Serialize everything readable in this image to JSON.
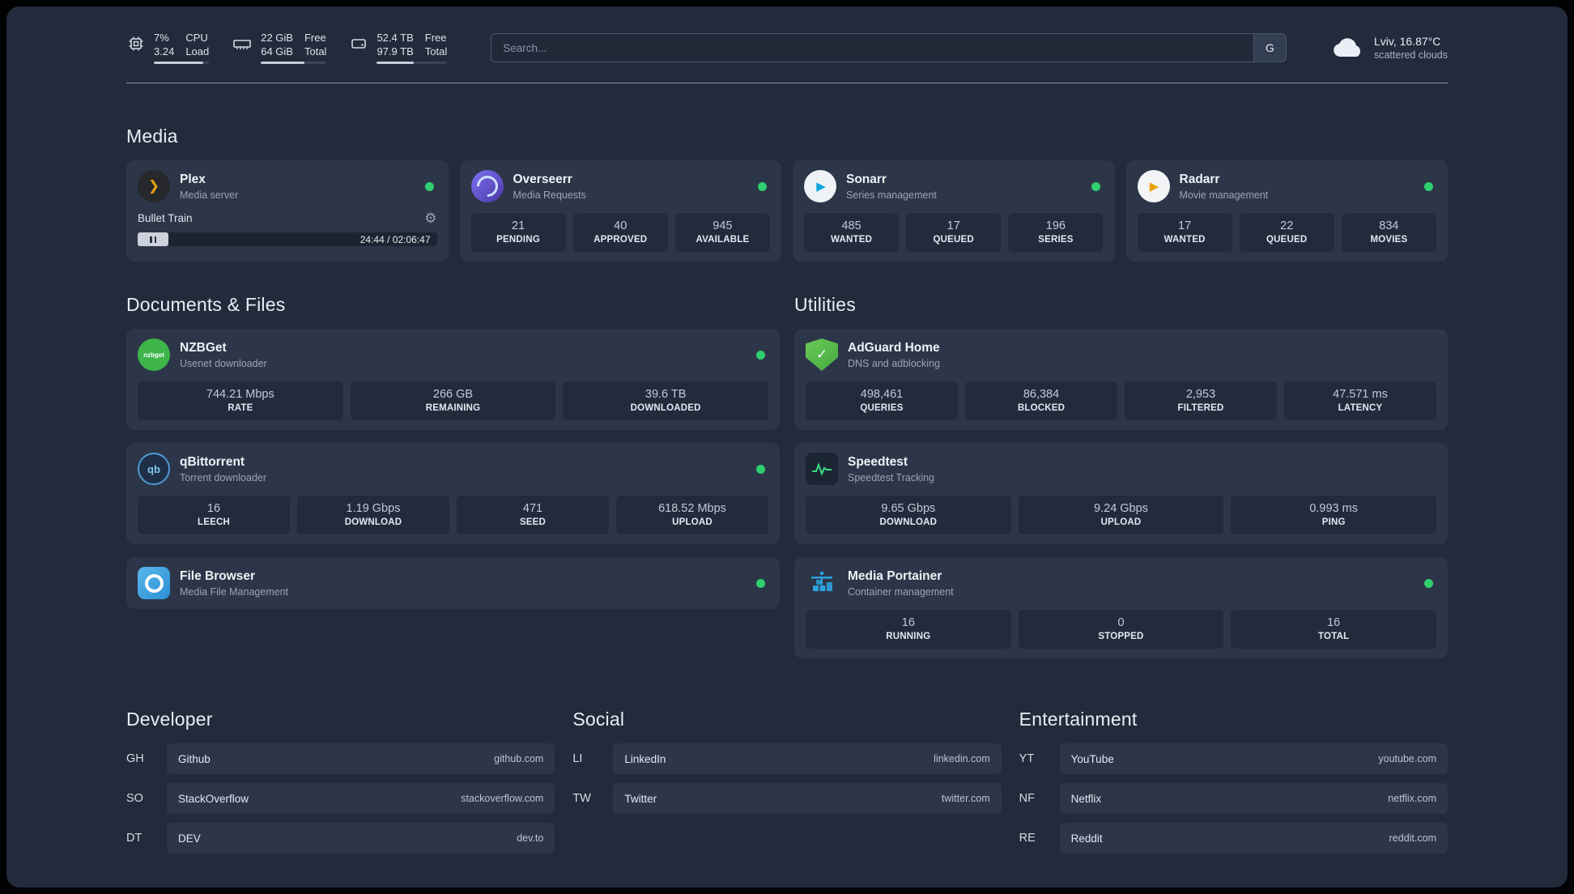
{
  "topbar": {
    "cpu": {
      "usage": "7%",
      "load": "3.24",
      "label_top": "CPU",
      "label_bottom": "Load"
    },
    "ram": {
      "free": "22 GiB",
      "total": "64 GiB",
      "label_top": "Free",
      "label_bottom": "Total"
    },
    "disk": {
      "free": "52.4 TB",
      "total": "97.9 TB",
      "label_top": "Free",
      "label_bottom": "Total"
    },
    "search": {
      "placeholder": "Search...",
      "button_label": "G"
    },
    "weather": {
      "location": "Lviv, 16.87°C",
      "condition": "scattered clouds"
    }
  },
  "sections": {
    "media": "Media",
    "documents": "Documents & Files",
    "utilities": "Utilities",
    "developer": "Developer",
    "social": "Social",
    "entertainment": "Entertainment"
  },
  "apps": {
    "plex": {
      "name": "Plex",
      "subtitle": "Media server",
      "now_playing": "Bullet Train",
      "time": "24:44 / 02:06:47"
    },
    "overseerr": {
      "name": "Overseerr",
      "subtitle": "Media Requests",
      "stats": [
        {
          "value": "21",
          "label": "PENDING"
        },
        {
          "value": "40",
          "label": "APPROVED"
        },
        {
          "value": "945",
          "label": "AVAILABLE"
        }
      ]
    },
    "sonarr": {
      "name": "Sonarr",
      "subtitle": "Series management",
      "stats": [
        {
          "value": "485",
          "label": "WANTED"
        },
        {
          "value": "17",
          "label": "QUEUED"
        },
        {
          "value": "196",
          "label": "SERIES"
        }
      ]
    },
    "radarr": {
      "name": "Radarr",
      "subtitle": "Movie management",
      "stats": [
        {
          "value": "17",
          "label": "WANTED"
        },
        {
          "value": "22",
          "label": "QUEUED"
        },
        {
          "value": "834",
          "label": "MOVIES"
        }
      ]
    },
    "nzbget": {
      "name": "NZBGet",
      "subtitle": "Usenet downloader",
      "icon_text": "nzbget",
      "stats": [
        {
          "value": "744.21 Mbps",
          "label": "RATE"
        },
        {
          "value": "266 GB",
          "label": "REMAINING"
        },
        {
          "value": "39.6 TB",
          "label": "DOWNLOADED"
        }
      ]
    },
    "qbittorrent": {
      "name": "qBittorrent",
      "subtitle": "Torrent downloader",
      "icon_text": "qb",
      "stats": [
        {
          "value": "16",
          "label": "LEECH"
        },
        {
          "value": "1.19 Gbps",
          "label": "DOWNLOAD"
        },
        {
          "value": "471",
          "label": "SEED"
        },
        {
          "value": "618.52 Mbps",
          "label": "UPLOAD"
        }
      ]
    },
    "filebrowser": {
      "name": "File Browser",
      "subtitle": "Media File Management"
    },
    "adguard": {
      "name": "AdGuard Home",
      "subtitle": "DNS and adblocking",
      "stats": [
        {
          "value": "498,461",
          "label": "QUERIES"
        },
        {
          "value": "86,384",
          "label": "BLOCKED"
        },
        {
          "value": "2,953",
          "label": "FILTERED"
        },
        {
          "value": "47.571 ms",
          "label": "LATENCY"
        }
      ]
    },
    "speedtest": {
      "name": "Speedtest",
      "subtitle": "Speedtest Tracking",
      "stats": [
        {
          "value": "9.65 Gbps",
          "label": "DOWNLOAD"
        },
        {
          "value": "9.24 Gbps",
          "label": "UPLOAD"
        },
        {
          "value": "0.993 ms",
          "label": "PING"
        }
      ]
    },
    "portainer": {
      "name": "Media Portainer",
      "subtitle": "Container management",
      "stats": [
        {
          "value": "16",
          "label": "RUNNING"
        },
        {
          "value": "0",
          "label": "STOPPED"
        },
        {
          "value": "16",
          "label": "TOTAL"
        }
      ]
    }
  },
  "bookmarks": {
    "developer": [
      {
        "abbr": "GH",
        "name": "Github",
        "url": "github.com"
      },
      {
        "abbr": "SO",
        "name": "StackOverflow",
        "url": "stackoverflow.com"
      },
      {
        "abbr": "DT",
        "name": "DEV",
        "url": "dev.to"
      }
    ],
    "social": [
      {
        "abbr": "LI",
        "name": "LinkedIn",
        "url": "linkedin.com"
      },
      {
        "abbr": "TW",
        "name": "Twitter",
        "url": "twitter.com"
      }
    ],
    "entertainment": [
      {
        "abbr": "YT",
        "name": "YouTube",
        "url": "youtube.com"
      },
      {
        "abbr": "NF",
        "name": "Netflix",
        "url": "netflix.com"
      },
      {
        "abbr": "RE",
        "name": "Reddit",
        "url": "reddit.com"
      }
    ]
  },
  "colors": {
    "status_green": "#2fcf6e",
    "plex_amber": "#e5a00d"
  }
}
